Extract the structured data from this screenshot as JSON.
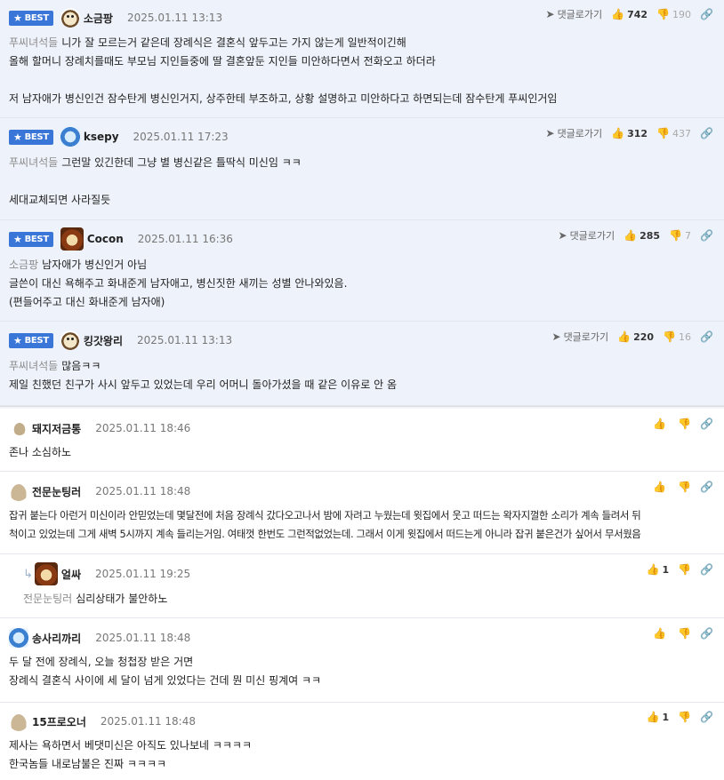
{
  "ui": {
    "best_label": "BEST",
    "reply_link_label": "댓글로가기"
  },
  "best_comments": [
    {
      "nick": "소금팡",
      "avatar": "dog-face",
      "date": "2025.01.11 13:13",
      "likes": "742",
      "dislikes": "190",
      "mention": "푸씨녀석들",
      "lines": [
        "니가 잘 모르는거 같은데 장례식은 결혼식 앞두고는 가지 않는게 일반적이긴해",
        "올해 할머니 장례치를때도 부모님 지인들중에 딸 결혼앞둔 지인들 미안하다면서 전화오고 하더라",
        "",
        "저 남자애가 병신인건 잠수탄게 병신인거지, 상주한테 부조하고, 상황 설명하고 미안하다고 하면되는데 잠수탄게 푸씨인거임"
      ]
    },
    {
      "nick": "ksepy",
      "avatar": "blue-ghost",
      "date": "2025.01.11 17:23",
      "likes": "312",
      "dislikes": "437",
      "mention": "푸씨녀석들",
      "lines": [
        "그런말 있긴한데 그냥 별 병신같은 틀딱식 미신임 ㅋㅋ",
        "",
        "세대교체되면 사라질듯"
      ]
    },
    {
      "nick": "Cocon",
      "avatar": "lion",
      "date": "2025.01.11 16:36",
      "likes": "285",
      "dislikes": "7",
      "mention": "소금팡",
      "lines": [
        "남자애가 병신인거 아님",
        "글쓴이 대신 욕해주고 화내준게 남자애고, 병신짓한 새끼는 성별 안나와있음.",
        "(편들어주고 대신 화내준게 남자애)"
      ]
    },
    {
      "nick": "킹갓왕리",
      "avatar": "dog-face",
      "date": "2025.01.11 13:13",
      "likes": "220",
      "dislikes": "16",
      "mention": "푸씨녀석들",
      "lines": [
        "많음ㅋㅋ",
        "제일 친했던 친구가 사시 앞두고 있었는데 우리 어머니 돌아가셨을 때 같은 이유로 안 옴"
      ]
    }
  ],
  "comments": [
    {
      "nick": "돼지저금통",
      "avatar": "stone",
      "date": "2025.01.11 18:46",
      "likes": "",
      "lines": [
        "존나 소심하노"
      ]
    },
    {
      "nick": "전문눈팅러",
      "avatar": "bread",
      "date": "2025.01.11 18:48",
      "likes": "",
      "lines": [
        "잡귀 붙는다 아런거 미신이라 안믿었는데 몇달전에 처음 장례식 갔다오고나서 밤에 자려고 누웠는데 윗집에서 웃고 떠드는 왁자지껄한 소리가 계속 들려서 뒤",
        "척이고 있었는데 그게 새벽 5시까지 계속 들리는거임. 여태껏 한번도 그런적없었는데. 그래서 이게 윗집에서 떠드는게 아니라 잡귀 붙은건가 싶어서 무서웠음"
      ]
    },
    {
      "nick": "얼싸",
      "avatar": "lion",
      "date": "2025.01.11 19:25",
      "likes": "1",
      "reply": true,
      "mention": "전문눈팅러",
      "lines": [
        "심리상태가 불안하노"
      ]
    },
    {
      "nick": "송사리까리",
      "avatar": "blue-ghost",
      "date": "2025.01.11 18:48",
      "likes": "",
      "lines": [
        "두 달 전에 장례식, 오늘 청첩장 받은 거면",
        "장례식 결혼식 사이에 세 달이 넘게 있었다는 건데 뭔 미신 핑계여 ㅋㅋ"
      ]
    },
    {
      "nick": "15프로오너",
      "avatar": "bread",
      "date": "2025.01.11 18:48",
      "likes": "1",
      "lines": [
        "제사는 욕하면서 베댓미신은 아직도 있나보네 ㅋㅋㅋㅋ",
        "한국놈들 내로남불은 진짜 ㅋㅋㅋㅋ"
      ]
    }
  ]
}
